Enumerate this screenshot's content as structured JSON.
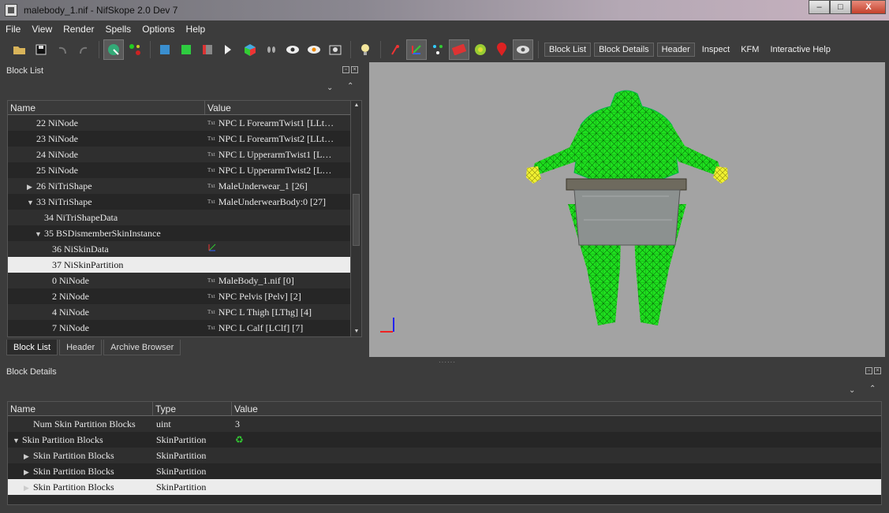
{
  "window": {
    "title": "malebody_1.nif - NifSkope 2.0 Dev 7",
    "minimize": "–",
    "maximize": "□",
    "close": "X"
  },
  "menu": [
    "File",
    "View",
    "Render",
    "Spells",
    "Options",
    "Help"
  ],
  "toolbar": {
    "icons": [
      "open-icon",
      "save-icon",
      "undo-icon",
      "redo-icon",
      "select-icon",
      "move-icon",
      "front-view-icon",
      "green-cube-icon",
      "red-cube-icon",
      "back-view-icon",
      "color-cube-icon",
      "footprint-icon",
      "eye-icon",
      "eye-orange-icon",
      "screenshot-icon",
      "light-bulb-icon",
      "pin-icon",
      "axes-icon",
      "nodes-icon",
      "texture-icon",
      "globe-icon",
      "marker-icon",
      "visibility-icon"
    ],
    "text_buttons": [
      "Block List",
      "Block Details",
      "Header",
      "Inspect",
      "KFM",
      "Interactive Help"
    ]
  },
  "block_list": {
    "title": "Block List",
    "columns": [
      "Name",
      "Value"
    ],
    "rows": [
      {
        "name": "22 NiNode",
        "value": "NPC L ForearmTwist1 [LLt…",
        "indent": 2,
        "arrow": "",
        "txt": true,
        "sel": false
      },
      {
        "name": "23 NiNode",
        "value": "NPC L ForearmTwist2 [LLt…",
        "indent": 2,
        "arrow": "",
        "txt": true,
        "sel": false
      },
      {
        "name": "24 NiNode",
        "value": "NPC L UpperarmTwist1 [L…",
        "indent": 2,
        "arrow": "",
        "txt": true,
        "sel": false
      },
      {
        "name": "25 NiNode",
        "value": "NPC L UpperarmTwist2 [L…",
        "indent": 2,
        "arrow": "",
        "txt": true,
        "sel": false
      },
      {
        "name": "26 NiTriShape",
        "value": "MaleUnderwear_1 [26]",
        "indent": 2,
        "arrow": "▶",
        "txt": true,
        "sel": false
      },
      {
        "name": "33 NiTriShape",
        "value": "MaleUnderwearBody:0 [27]",
        "indent": 2,
        "arrow": "▼",
        "txt": true,
        "sel": false
      },
      {
        "name": "34 NiTriShapeData",
        "value": "",
        "indent": 3,
        "arrow": "",
        "txt": false,
        "sel": false
      },
      {
        "name": "35 BSDismemberSkinInstance",
        "value": "",
        "indent": 3,
        "arrow": "▼",
        "txt": false,
        "sel": false
      },
      {
        "name": "36 NiSkinData",
        "value": "",
        "indent": 4,
        "arrow": "",
        "txt": false,
        "sel": false,
        "axis": true
      },
      {
        "name": "37 NiSkinPartition",
        "value": "",
        "indent": 4,
        "arrow": "",
        "txt": false,
        "sel": true
      },
      {
        "name": "0 NiNode",
        "value": "MaleBody_1.nif [0]",
        "indent": 4,
        "arrow": "",
        "txt": true,
        "sel": false
      },
      {
        "name": "2 NiNode",
        "value": "NPC Pelvis [Pelv] [2]",
        "indent": 4,
        "arrow": "",
        "txt": true,
        "sel": false
      },
      {
        "name": "4 NiNode",
        "value": "NPC L Thigh [LThg] [4]",
        "indent": 4,
        "arrow": "",
        "txt": true,
        "sel": false
      },
      {
        "name": "7 NiNode",
        "value": "NPC L Calf [LClf] [7]",
        "indent": 4,
        "arrow": "",
        "txt": true,
        "sel": false
      }
    ],
    "txt_label": "Txt",
    "tabs": [
      "Block List",
      "Header",
      "Archive Browser"
    ]
  },
  "block_details": {
    "title": "Block Details",
    "columns": [
      "Name",
      "Type",
      "Value"
    ],
    "rows": [
      {
        "name": "Num Skin Partition Blocks",
        "type": "uint",
        "value": "3",
        "indent": 1,
        "arrow": "",
        "sel": false,
        "refresh": false
      },
      {
        "name": "Skin Partition Blocks",
        "type": "SkinPartition",
        "value": "",
        "indent": 0,
        "arrow": "▼",
        "sel": false,
        "refresh": true
      },
      {
        "name": "Skin Partition Blocks",
        "type": "SkinPartition",
        "value": "",
        "indent": 1,
        "arrow": "▶",
        "sel": false,
        "refresh": false
      },
      {
        "name": "Skin Partition Blocks",
        "type": "SkinPartition",
        "value": "",
        "indent": 1,
        "arrow": "▶",
        "sel": false,
        "refresh": false
      },
      {
        "name": "Skin Partition Blocks",
        "type": "SkinPartition",
        "value": "",
        "indent": 1,
        "arrow": "▶",
        "sel": true,
        "refresh": false
      }
    ]
  },
  "colors": {
    "mesh": "#22ee22",
    "hands": "#e8e820",
    "viewport_bg": "#a3a3a3"
  }
}
